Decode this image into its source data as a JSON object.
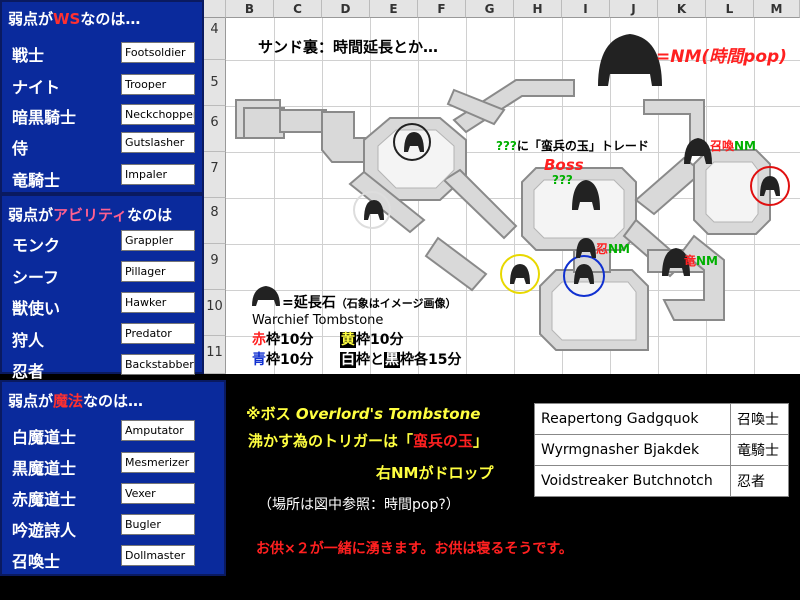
{
  "ws_panel": {
    "header_pre": "弱点が",
    "header_hl": "WS",
    "header_post": "なのは…",
    "rows": [
      {
        "job": "戦士",
        "monster": "Footsoldier"
      },
      {
        "job": "ナイト",
        "monster": "Trooper"
      },
      {
        "job": "暗黒騎士",
        "monster": "Neckchopper"
      },
      {
        "job": "侍",
        "monster": "Gutslasher"
      },
      {
        "job": "竜騎士",
        "monster": "Impaler"
      }
    ]
  },
  "ability_panel": {
    "header_pre": "弱点が",
    "header_hl": "アビリティ",
    "header_post": "なのは",
    "rows": [
      {
        "job": "モンク",
        "monster": "Grappler"
      },
      {
        "job": "シーフ",
        "monster": "Pillager"
      },
      {
        "job": "獣使い",
        "monster": "Hawker"
      },
      {
        "job": "狩人",
        "monster": "Predator"
      },
      {
        "job": "忍者",
        "monster": "Backstabber"
      }
    ]
  },
  "magic_panel": {
    "header_pre": "弱点が",
    "header_hl": "魔法",
    "header_post": "なのは…",
    "rows": [
      {
        "job": "白魔道士",
        "monster": "Amputator"
      },
      {
        "job": "黒魔道士",
        "monster": "Mesmerizer"
      },
      {
        "job": "赤魔道士",
        "monster": "Vexer"
      },
      {
        "job": "吟遊詩人",
        "monster": "Bugler"
      },
      {
        "job": "召喚士",
        "monster": "Dollmaster"
      }
    ]
  },
  "map": {
    "columns": [
      "B",
      "C",
      "D",
      "E",
      "F",
      "G",
      "H",
      "I",
      "J",
      "K",
      "L",
      "M"
    ],
    "rows": [
      "4",
      "5",
      "6",
      "7",
      "8",
      "9",
      "10",
      "11"
    ],
    "title": "サンド裏：時間延長とか…",
    "nm_label": "=NM(時間pop)",
    "trade_text_q": "???",
    "trade_text_main": "に「蛮兵の玉」トレード",
    "boss_label": "Boss",
    "boss_q": "???",
    "summoner_nm_1": "召喚",
    "summoner_nm_2": "NM",
    "ninja_nm_1": "忍",
    "ninja_nm_2": "NM",
    "dragoon_nm_1": "竜",
    "dragoon_nm_2": "NM",
    "legend_stone": "=延長石",
    "legend_note": "（石象はイメージ画像）",
    "legend_name": "Warchief Tombstone",
    "time_red": "赤",
    "time_red_rest": "枠10分",
    "time_yellow": "黄",
    "time_yellow_rest": "枠10分",
    "time_blue": "青",
    "time_blue_rest": "枠10分",
    "time_white": "白",
    "time_white_mid": "枠と",
    "time_black": "黒",
    "time_black_rest": "枠各15分"
  },
  "info": {
    "boss_line_pre": "※ボス ",
    "boss_name": "Overlord's Tombstone",
    "trigger_pre": "沸かす為のトリガーは「",
    "trigger_item": "蛮兵の玉",
    "trigger_post": "」",
    "drop_line": "右NMがドロップ",
    "location_line": "（場所は図中参照：時間pop?）",
    "note_line": "お供×２が一緒に湧きます。お供は寝るそうです。"
  },
  "nm_table": [
    {
      "name": "Reapertong Gadgquok",
      "job": "召喚士"
    },
    {
      "name": "Wyrmgnasher Bjakdek",
      "job": "竜騎士"
    },
    {
      "name": "Voidstreaker Butchnotch",
      "job": "忍者"
    }
  ],
  "colors": {
    "panel_bg": "#0a2a9c",
    "accent_yellow": "#ffff40",
    "accent_red": "#ff2020",
    "accent_green": "#00b000",
    "nm_label_red": "#ff2020"
  }
}
